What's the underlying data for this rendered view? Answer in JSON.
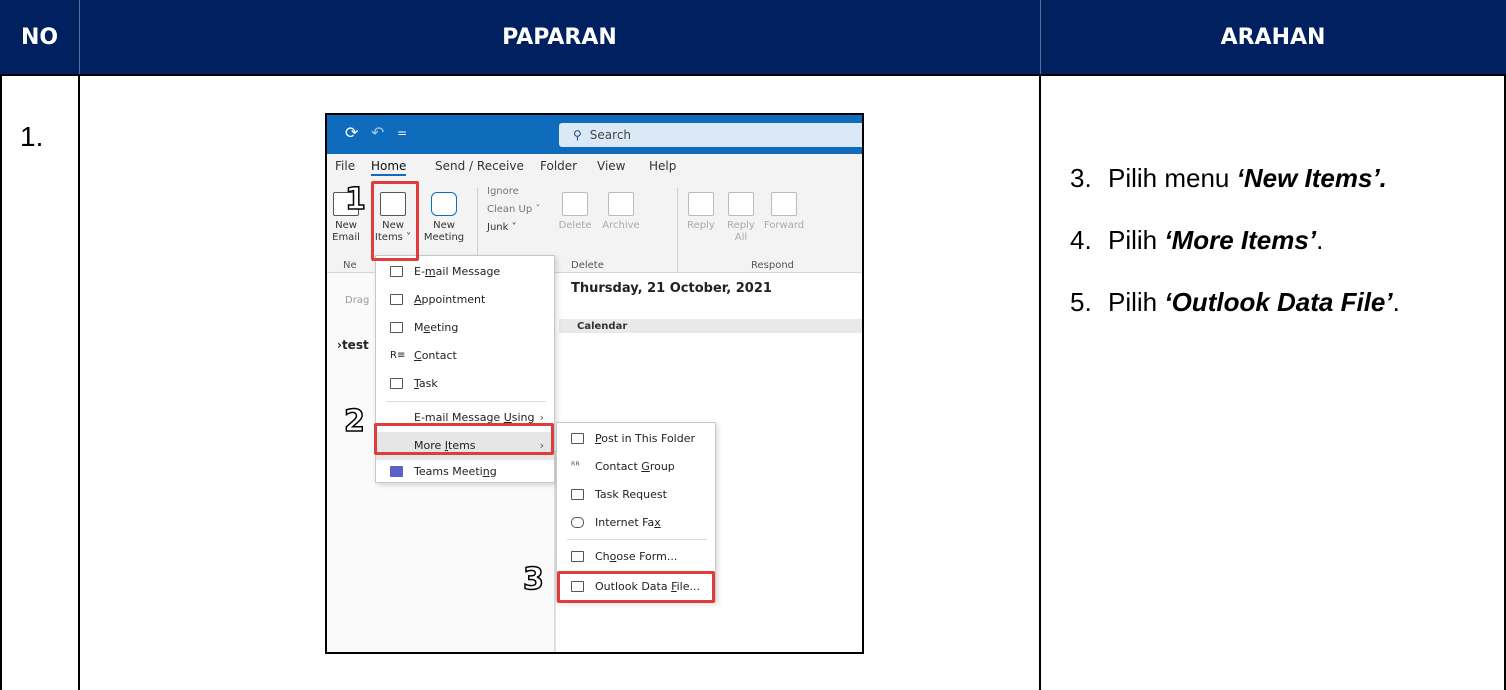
{
  "table": {
    "headers": {
      "no": "NO",
      "paparan": "PAPARAN",
      "arahan": "ARAHAN"
    },
    "row_number": "1."
  },
  "instructions": [
    {
      "num": "3.",
      "prefix": "Pilih menu ",
      "bold": "‘New Items’.",
      "suffix": ""
    },
    {
      "num": "4.",
      "prefix": "Pilih ",
      "bold": "‘More Items’",
      "suffix": "."
    },
    {
      "num": "5.",
      "prefix": "Pilih ",
      "bold": "‘Outlook Data File’",
      "suffix": "."
    }
  ],
  "screenshot": {
    "search_label": "Search",
    "tabs": [
      "File",
      "Home",
      "Send / Receive",
      "Folder",
      "View",
      "Help"
    ],
    "ribbon": {
      "new_email": [
        "New",
        "Email"
      ],
      "new_items": [
        "New",
        "Items ˅"
      ],
      "new_meeting": [
        "New",
        "Meeting"
      ],
      "ignore": "Ignore",
      "clean_up": "Clean Up ˅",
      "junk": "Junk ˅",
      "delete": "Delete",
      "archive": "Archive",
      "reply": "Reply",
      "reply_all": [
        "Reply",
        "All"
      ],
      "forward": "Forward",
      "group_new": "Ne",
      "group_delete": "Delete",
      "group_respond": "Respond"
    },
    "nav": {
      "drag": "Drag",
      "folder": "›test"
    },
    "date": "Thursday, 21 October, 2021",
    "calendar": "Calendar",
    "new_items_menu": {
      "email_message": [
        "E-",
        "m",
        "ail Message"
      ],
      "appointment": [
        "",
        "A",
        "ppointment"
      ],
      "meeting": [
        "M",
        "e",
        "eting"
      ],
      "contact": [
        "",
        "C",
        "ontact"
      ],
      "task": [
        "",
        "T",
        "ask"
      ],
      "email_using": [
        "E-mail Message ",
        "U",
        "sing"
      ],
      "more_items": [
        "More ",
        "I",
        "tems"
      ],
      "teams_meeting": [
        "Teams Meeti",
        "n",
        "g"
      ]
    },
    "more_items_menu": {
      "post": [
        "",
        "P",
        "ost in This Folder"
      ],
      "contact_group": [
        "Contact ",
        "G",
        "roup"
      ],
      "task_request": "Task Request",
      "internet_fax": [
        "Internet Fa",
        "x",
        ""
      ],
      "choose_form": [
        "Ch",
        "o",
        "ose Form..."
      ],
      "outlook_data_file": [
        "Outlook Data ",
        "F",
        "ile..."
      ]
    },
    "callouts": [
      "1",
      "2",
      "3"
    ]
  },
  "colors": {
    "header_bg": "#002060",
    "highlight": "#e03c3c",
    "titlebar": "#0f6cbd"
  }
}
